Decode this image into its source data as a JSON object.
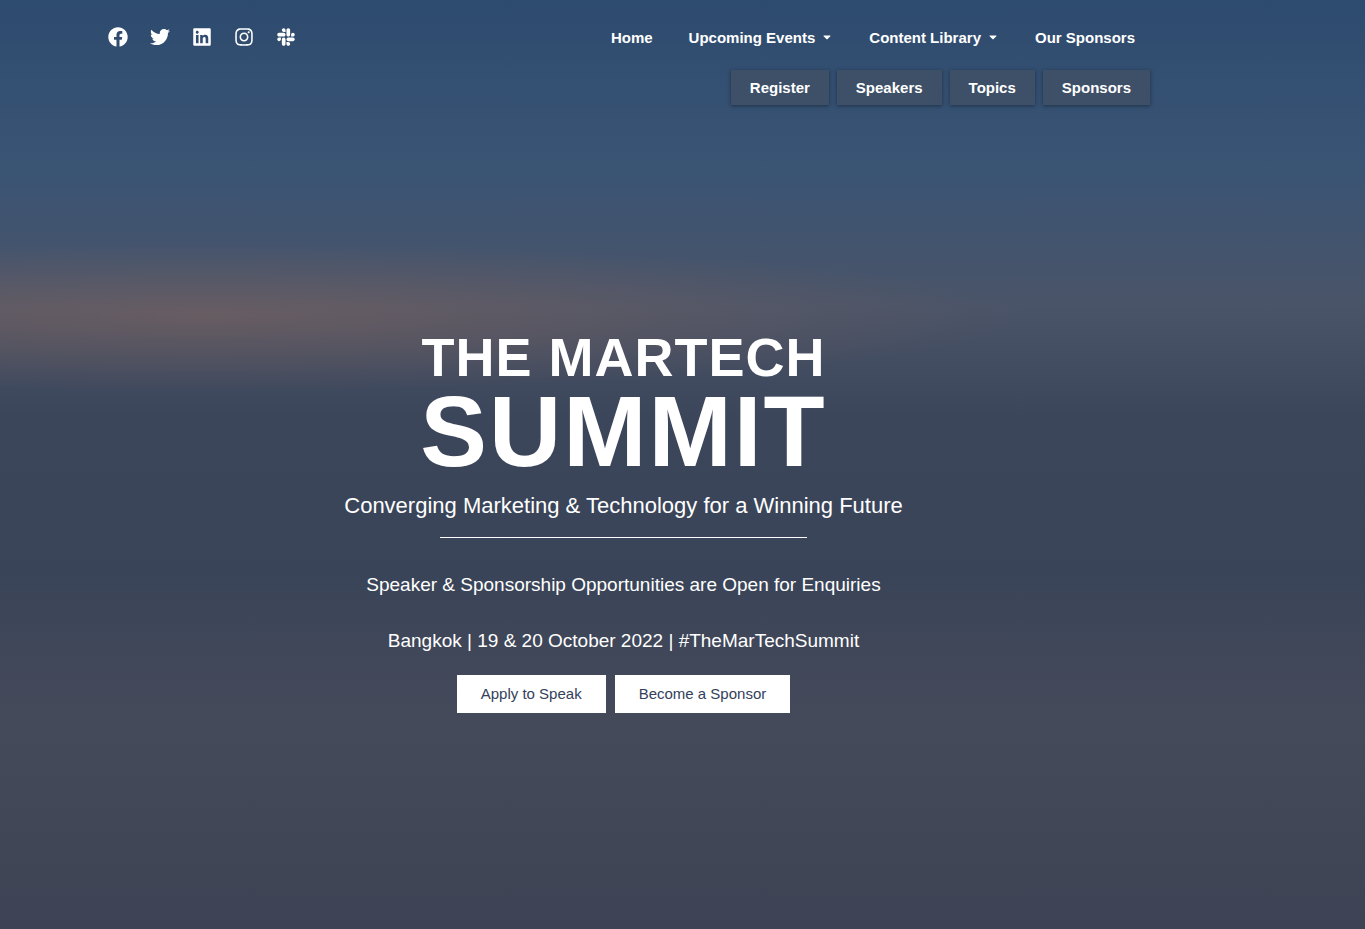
{
  "menu": [
    {
      "label": "Home",
      "dropdown": false
    },
    {
      "label": "Upcoming Events",
      "dropdown": true
    },
    {
      "label": "Content Library",
      "dropdown": true
    },
    {
      "label": "Our Sponsors",
      "dropdown": false
    }
  ],
  "quick_links": [
    "Register",
    "Speakers",
    "Topics",
    "Sponsors"
  ],
  "hero": {
    "title_line1": "THE MARTECH",
    "title_line2": "SUMMIT",
    "tagline": "Converging Marketing & Technology for a Winning Future",
    "notice": "Speaker & Sponsorship Opportunities are Open for Enquiries",
    "details": "Bangkok | 19 & 20 October 2022 | #TheMarTechSummit",
    "buttons": [
      "Apply to Speak",
      "Become a Sponsor"
    ]
  }
}
